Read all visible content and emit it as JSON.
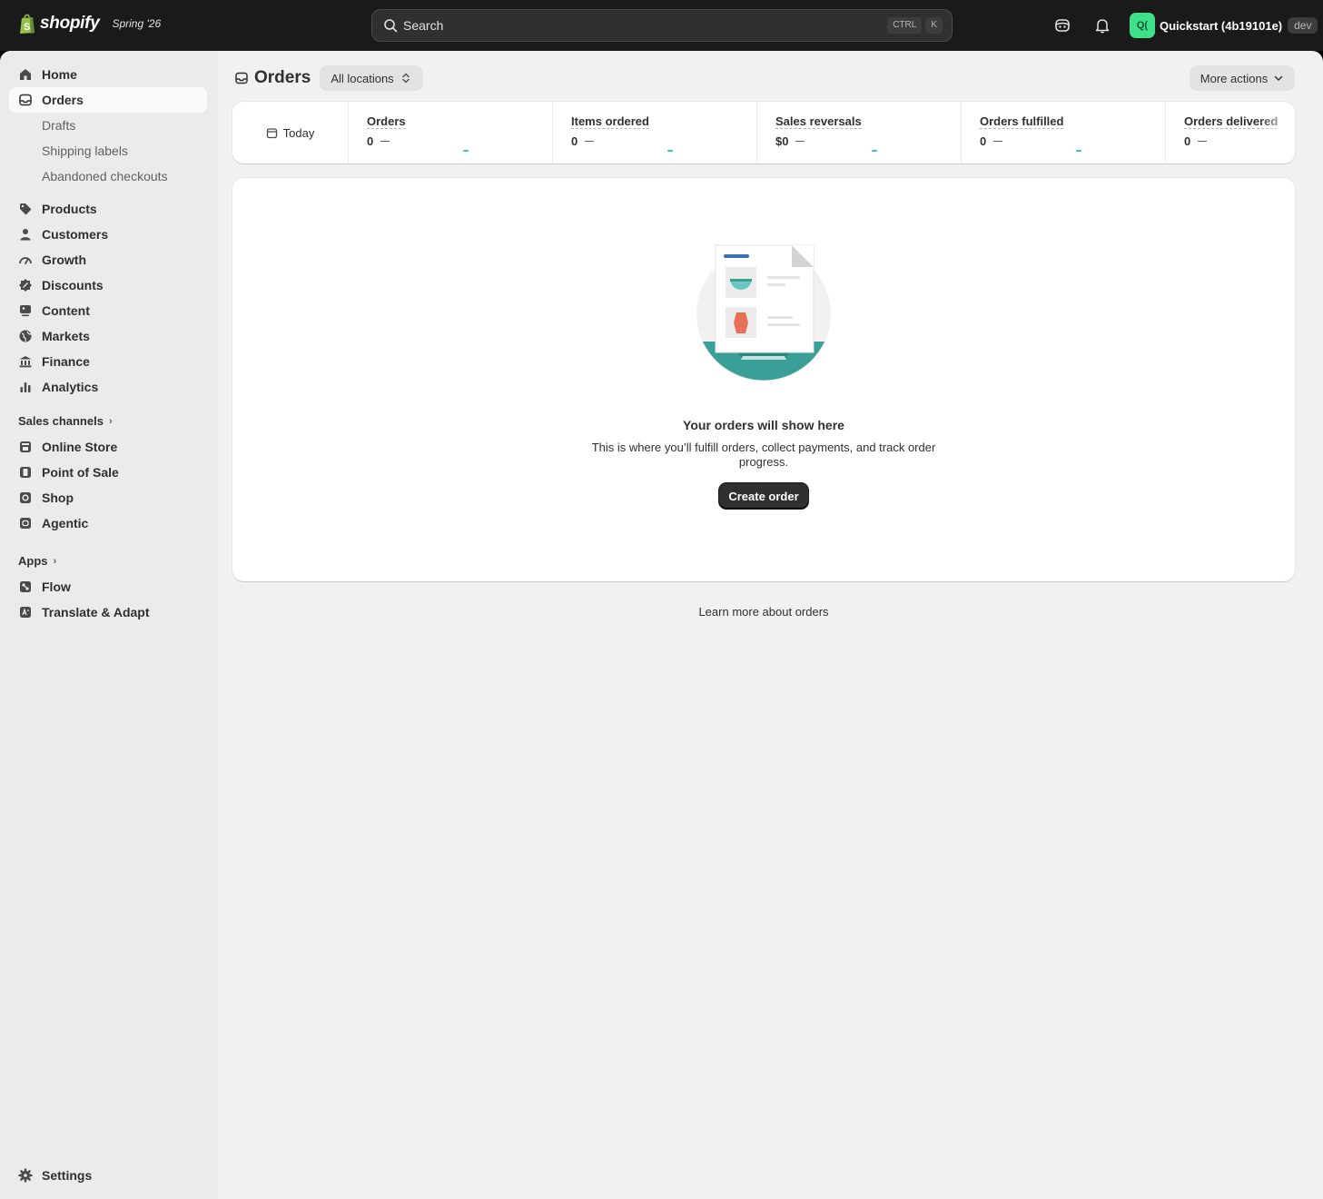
{
  "topbar": {
    "brand": "shopify",
    "edition": "Spring '26",
    "search_placeholder": "Search",
    "shortcut_keys": [
      "CTRL",
      "K"
    ],
    "store_initials": "Q(",
    "store_name": "Quickstart (4b19101e)",
    "store_badge": "dev"
  },
  "sidebar": {
    "home": "Home",
    "orders": "Orders",
    "orders_sub": [
      "Drafts",
      "Shipping labels",
      "Abandoned checkouts"
    ],
    "main_items": [
      "Products",
      "Customers",
      "Growth",
      "Discounts",
      "Content",
      "Markets",
      "Finance",
      "Analytics"
    ],
    "sales_channels_label": "Sales channels",
    "sales_channels": [
      "Online Store",
      "Point of Sale",
      "Shop",
      "Agentic"
    ],
    "apps_label": "Apps",
    "apps": [
      "Flow",
      "Translate & Adapt"
    ],
    "settings": "Settings"
  },
  "page": {
    "title": "Orders",
    "location_filter": "All locations",
    "more_actions": "More actions"
  },
  "metrics": {
    "date_range": "Today",
    "items": [
      {
        "label": "Orders",
        "value": "0"
      },
      {
        "label": "Items ordered",
        "value": "0"
      },
      {
        "label": "Sales reversals",
        "value": "$0"
      },
      {
        "label": "Orders fulfilled",
        "value": "0"
      },
      {
        "label": "Orders delivered",
        "value": "0"
      }
    ]
  },
  "empty_state": {
    "title": "Your orders will show here",
    "body": "This is where you’ll fulfill orders, collect payments, and track order progress.",
    "cta": "Create order"
  },
  "footer_link": "Learn more about orders",
  "colors": {
    "topbar": "#1a1a1a",
    "store_avatar": "#3fe08a",
    "accent_teal": "#3a9f98",
    "sparkline": "#36bfd9"
  }
}
